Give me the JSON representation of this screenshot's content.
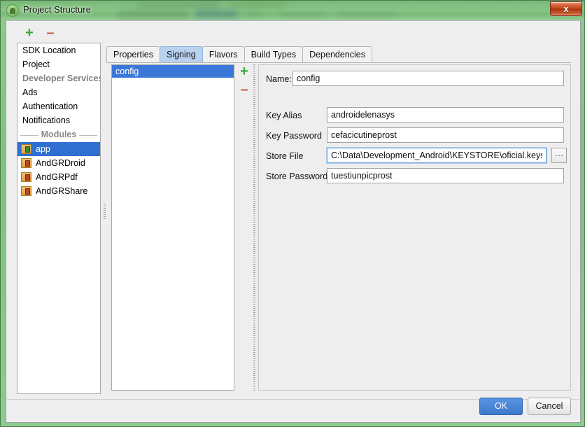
{
  "window": {
    "title": "Project Structure",
    "icon": "android-icon",
    "close_label": "x"
  },
  "sidebar": {
    "toolbar": {
      "add_label": "+",
      "remove_label": "–"
    },
    "items": [
      {
        "label": "SDK Location",
        "type": "item"
      },
      {
        "label": "Project",
        "type": "item"
      },
      {
        "label": "Developer Services",
        "type": "group"
      },
      {
        "label": "Ads",
        "type": "item"
      },
      {
        "label": "Authentication",
        "type": "item"
      },
      {
        "label": "Notifications",
        "type": "item"
      }
    ],
    "modules_header": "Modules",
    "modules": [
      {
        "label": "app",
        "icon": "module-app-icon",
        "selected": true
      },
      {
        "label": "AndGRDroid",
        "icon": "module-library-icon",
        "selected": false
      },
      {
        "label": "AndGRPdf",
        "icon": "module-library-icon",
        "selected": false
      },
      {
        "label": "AndGRShare",
        "icon": "module-library-icon",
        "selected": false
      }
    ]
  },
  "tabs": [
    {
      "label": "Properties",
      "active": false
    },
    {
      "label": "Signing",
      "active": true
    },
    {
      "label": "Flavors",
      "active": false
    },
    {
      "label": "Build Types",
      "active": false
    },
    {
      "label": "Dependencies",
      "active": false
    }
  ],
  "config_list": {
    "toolbar": {
      "add_label": "+",
      "remove_label": "–"
    },
    "rows": [
      {
        "label": "config",
        "selected": true
      }
    ]
  },
  "form": {
    "name_label": "Name:",
    "name_value": "config",
    "fields": [
      {
        "label": "Key Alias",
        "value": "androidelenasys",
        "focused": false
      },
      {
        "label": "Key Password",
        "value": "cefacicutineprost",
        "focused": false
      },
      {
        "label": "Store File",
        "value": "C:\\Data\\Development_Android\\KEYSTORE\\oficial.keystore",
        "focused": true
      },
      {
        "label": "Store Password",
        "value": "tuestiunpicprost",
        "focused": false
      }
    ],
    "browse_label": "…"
  },
  "footer": {
    "ok_label": "OK",
    "cancel_label": "Cancel"
  },
  "colors": {
    "frame_green": "#8ecb8e",
    "selection_blue": "#3b77d8",
    "tab_active_blue": "#b8d2f0",
    "accent_add_green": "#3aa83a",
    "accent_remove_red": "#cf5540",
    "primary_button_blue": "#3d78cc"
  }
}
